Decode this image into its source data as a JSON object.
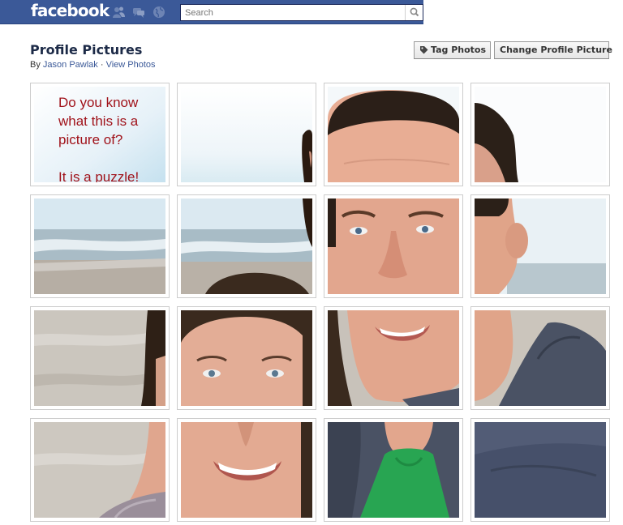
{
  "app": {
    "brand": "facebook",
    "search_placeholder": "Search",
    "icons": [
      "friends-icon",
      "messages-icon",
      "notifications-globe-icon",
      "search-icon"
    ]
  },
  "header": {
    "title": "Profile Pictures",
    "by_prefix": "By",
    "author": "Jason Pawlak",
    "separator": "·",
    "view_photos": "View Photos",
    "tag_photos": "Tag Photos",
    "change_profile_picture": "Change Profile Picture"
  },
  "tile1_text": "Do you know\nwhat this is a\npicture of?\n\nIt is a puzzle!",
  "colors": {
    "brand_blue": "#3b5998",
    "title_navy": "#1c2a47",
    "puzzle_text_red": "#a0121a"
  }
}
